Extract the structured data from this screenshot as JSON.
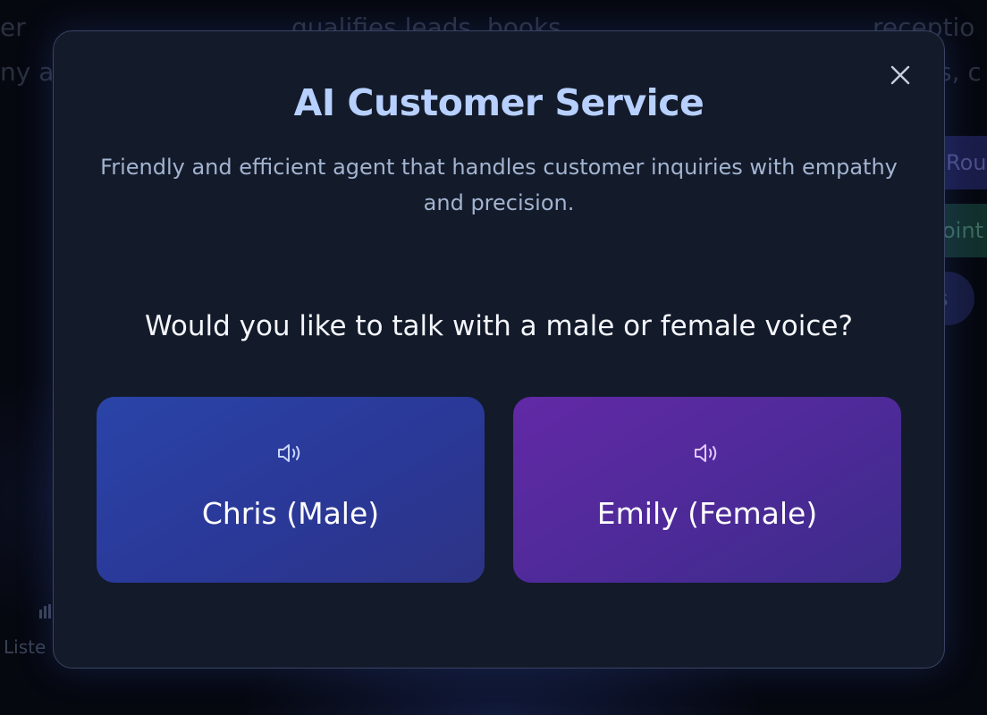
{
  "background": {
    "fragments": [
      "er",
      "ny ar",
      "qualifies leads, books",
      "receptio",
      "s, c",
      "Rou",
      "oint",
      "s",
      "Liste"
    ]
  },
  "modal": {
    "title": "AI Customer Service",
    "subtitle": "Friendly and efficient agent that handles customer inquiries with empathy and precision.",
    "question": "Would you like to talk with a male or female voice?",
    "close_icon": "close-icon",
    "options": [
      {
        "label": "Chris (Male)",
        "icon": "speaker-icon",
        "accent": "#2a44a8"
      },
      {
        "label": "Emily (Female)",
        "icon": "speaker-icon",
        "accent": "#6229a6"
      }
    ]
  },
  "colors": {
    "title": "#b7d0ff",
    "modal_bg": "#131a2a",
    "modal_border": "#3a4462"
  }
}
